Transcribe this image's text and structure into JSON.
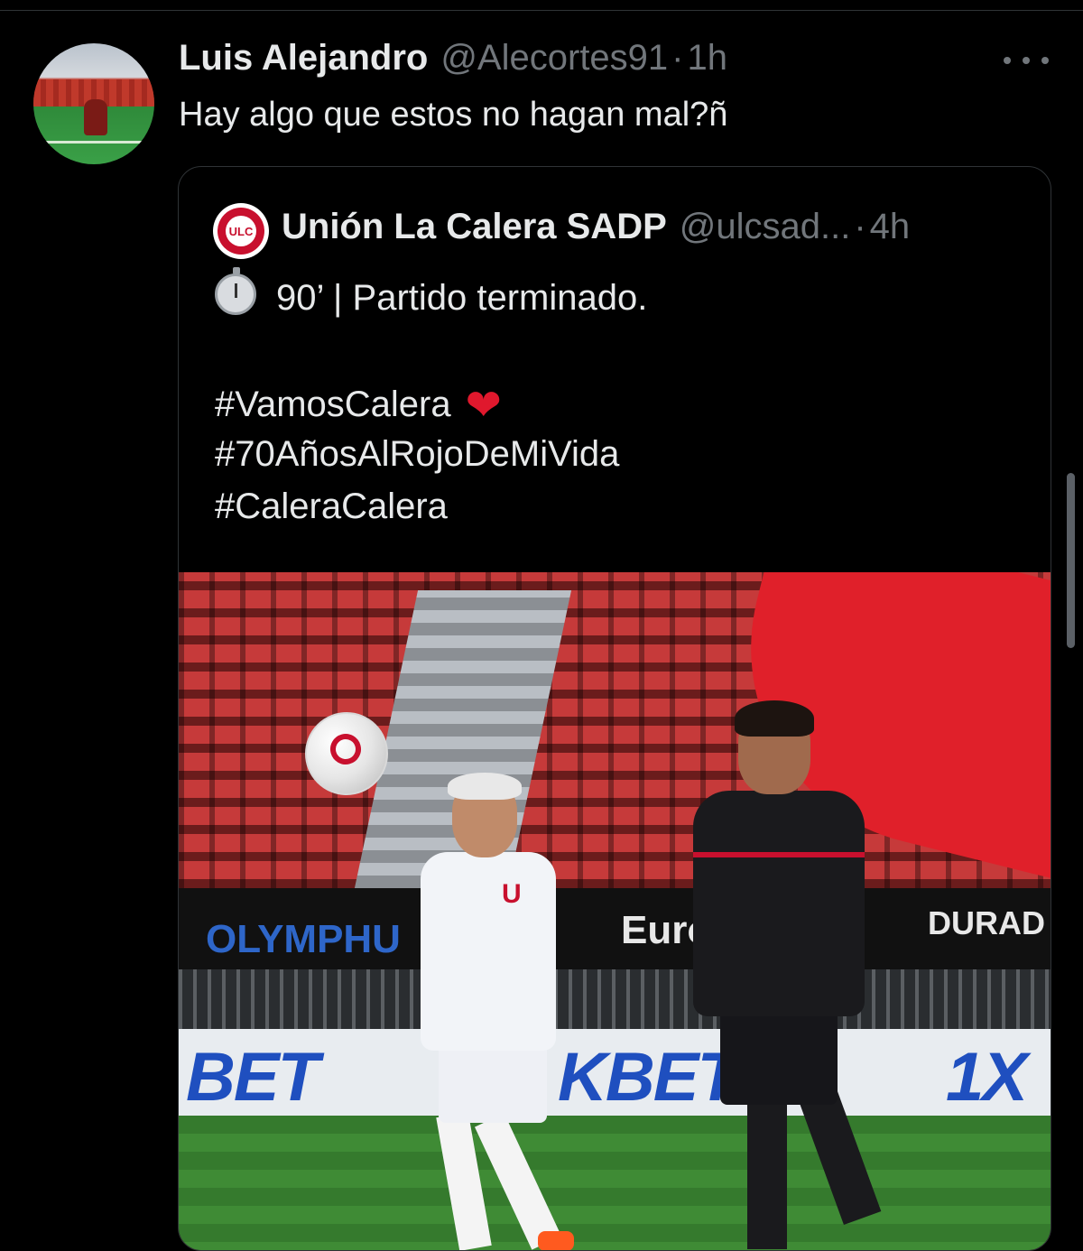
{
  "tweet": {
    "author_name": "Luis Alejandro",
    "author_handle": "@Alecortes91",
    "separator": "·",
    "time": "1h",
    "text": "Hay algo que estos no hagan mal?ñ"
  },
  "quoted_tweet": {
    "logo_text": "ULC",
    "author_name": "Unión La Calera SADP",
    "author_handle": "@ulcsad...",
    "separator": "·",
    "time": "4h",
    "line1": "90’ | Partido terminado.",
    "hashtag1": "#VamosCalera",
    "hashtag2": "#70AñosAlRojoDeMiVida",
    "hashtag3": "#CaleraCalera",
    "heart_emoji": "❤"
  },
  "photo": {
    "board_left": "OLYMPHU",
    "board_mid": "Eurofa",
    "board_right": "DURAD",
    "ad_left": "BET",
    "ad_mid": "KBET",
    "ad_right": "1X"
  },
  "icons": {
    "more": "more-horizontal-icon",
    "stopwatch": "stopwatch-icon",
    "heart": "heart-icon"
  }
}
